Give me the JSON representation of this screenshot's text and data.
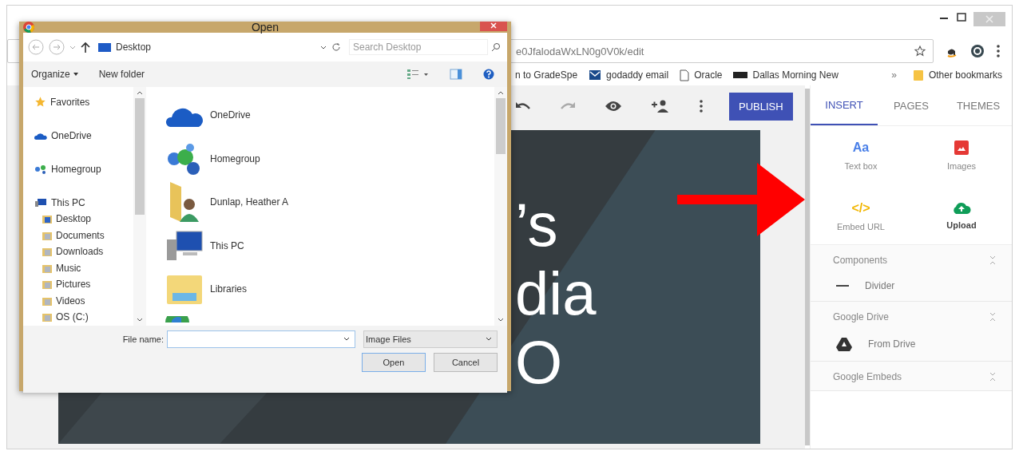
{
  "browser": {
    "address": "e0JfalodaWxLN0g0V0k/edit",
    "bookmarks": [
      {
        "label": "n to GradeSpe"
      },
      {
        "label": "godaddy email"
      },
      {
        "label": "Oracle"
      },
      {
        "label": "Dallas Morning New"
      }
    ],
    "bookmarks_more": "»",
    "other_bookmarks": "Other bookmarks"
  },
  "editor": {
    "publish": "PUBLISH",
    "redo_disabled": true,
    "title_lines": [
      "’s",
      "dia",
      "O"
    ]
  },
  "panel": {
    "tabs": [
      {
        "label": "INSERT",
        "selected": true
      },
      {
        "label": "PAGES",
        "selected": false
      },
      {
        "label": "THEMES",
        "selected": false
      }
    ],
    "insert_items": [
      {
        "glyph": "Aa",
        "label": "Text box",
        "emphasized": false
      },
      {
        "label": "Images",
        "emphasized": false
      },
      {
        "glyph": "</>",
        "label": "Embed URL",
        "emphasized": false
      },
      {
        "label": "Upload",
        "emphasized": true
      }
    ],
    "sections": [
      {
        "title": "Components",
        "items": [
          "Divider"
        ]
      },
      {
        "title": "Google Drive",
        "items": [
          "From Drive"
        ]
      },
      {
        "title": "Google Embeds"
      }
    ]
  },
  "dialog": {
    "title": "Open",
    "location": "Desktop",
    "search_placeholder": "Search Desktop",
    "organize": "Organize",
    "new_folder": "New folder",
    "nav_tree": [
      {
        "label": "Favorites"
      },
      {
        "label": "OneDrive"
      },
      {
        "label": "Homegroup"
      },
      {
        "label": "This PC",
        "children": [
          {
            "label": "Desktop"
          },
          {
            "label": "Documents"
          },
          {
            "label": "Downloads"
          },
          {
            "label": "Music"
          },
          {
            "label": "Pictures"
          },
          {
            "label": "Videos"
          },
          {
            "label": "OS (C:)"
          }
        ]
      }
    ],
    "items": [
      "OneDrive",
      "Homegroup",
      "Dunlap, Heather A",
      "This PC",
      "Libraries"
    ],
    "file_name_label": "File name:",
    "file_type": "Image Files",
    "buttons": [
      "Open",
      "Cancel"
    ]
  }
}
